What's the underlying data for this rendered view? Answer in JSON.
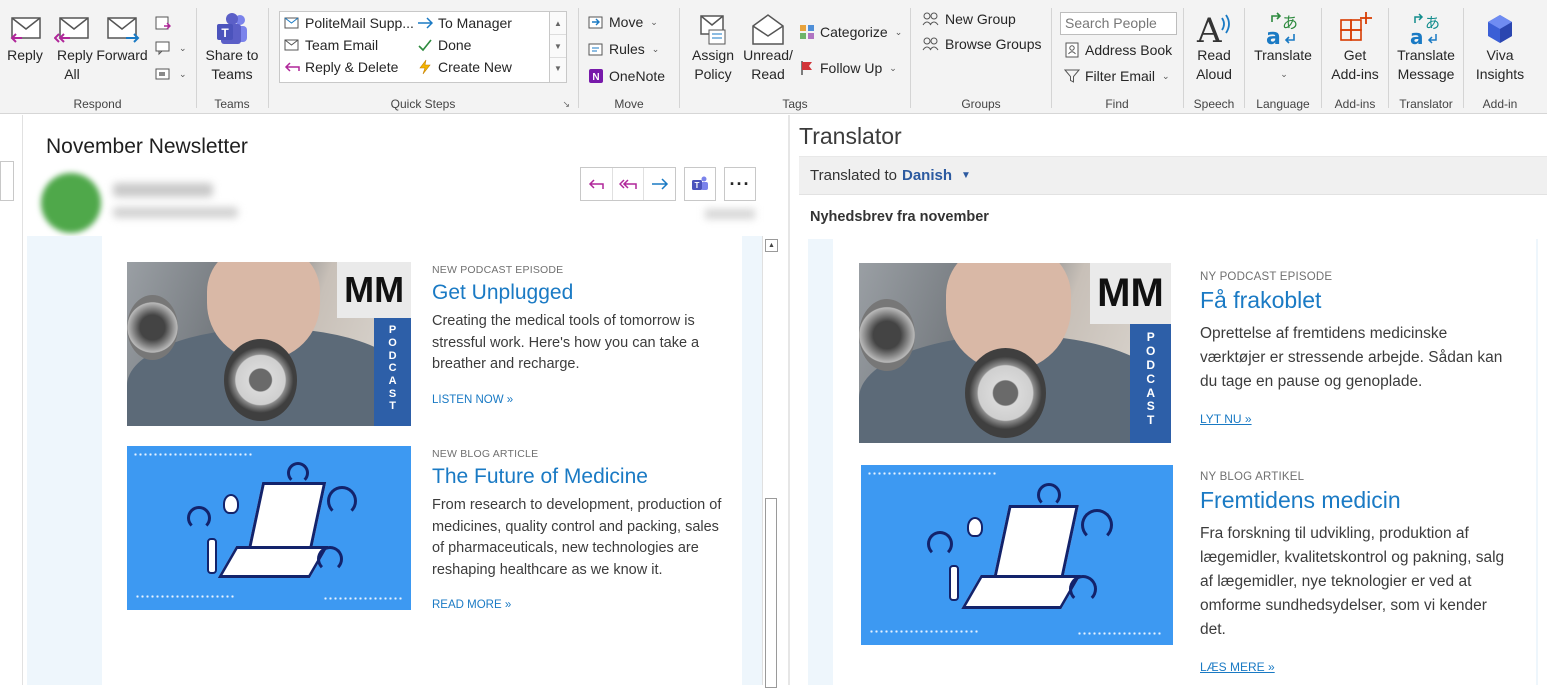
{
  "ribbon": {
    "respond": {
      "label": "Respond",
      "reply": "Reply",
      "reply_all": "Reply All",
      "forward": "Forward"
    },
    "teams": {
      "label": "Teams",
      "share_to_teams": "Share to Teams"
    },
    "quick_steps": {
      "label": "Quick Steps",
      "items": [
        "PoliteMail Supp...",
        "To Manager",
        "Team Email",
        "Done",
        "Reply & Delete",
        "Create New"
      ]
    },
    "move": {
      "label": "Move",
      "move": "Move",
      "rules": "Rules",
      "onenote": "OneNote"
    },
    "tags": {
      "label": "Tags",
      "assign_policy": "Assign Policy",
      "unread_read": "Unread/ Read",
      "categorize": "Categorize",
      "follow_up": "Follow Up"
    },
    "groups": {
      "label": "Groups",
      "new_group": "New Group",
      "browse_groups": "Browse Groups"
    },
    "find": {
      "label": "Find",
      "search_people_placeholder": "Search People",
      "address_book": "Address Book",
      "filter_email": "Filter Email"
    },
    "speech": {
      "label": "Speech",
      "read_aloud": "Read Aloud"
    },
    "language": {
      "label": "Language",
      "translate": "Translate"
    },
    "addins": {
      "label": "Add-ins",
      "get_addins": "Get Add-ins"
    },
    "translator": {
      "label": "Translator",
      "translate_message": "Translate Message"
    },
    "addin": {
      "label": "Add-in",
      "viva_insights": "Viva Insights"
    }
  },
  "message": {
    "subject": "November Newsletter",
    "articles": [
      {
        "kicker": "NEW PODCAST EPISODE",
        "title": "Get Unplugged",
        "text": "Creating the medical tools of tomorrow is stressful work. Here's how you can take a breather and recharge.",
        "link": "LISTEN NOW »"
      },
      {
        "kicker": "NEW BLOG ARTICLE",
        "title": "The Future of Medicine",
        "text": "From research to development, production of medicines, quality control and packing, sales of pharmaceuticals, new technologies are reshaping healthcare as we know it.",
        "link": "READ MORE »"
      }
    ],
    "podcast_image": {
      "logo": "MM",
      "vertical_text": "PODCAST"
    }
  },
  "translator": {
    "title": "Translator",
    "translated_to_label": "Translated to",
    "language": "Danish",
    "subject": "Nyhedsbrev fra november",
    "articles": [
      {
        "kicker": "NY PODCAST EPISODE",
        "title": "Få frakoblet",
        "text": "Oprettelse af fremtidens medicinske værktøjer er stressende arbejde. Sådan kan du tage en pause og genoplade.",
        "link": "LYT NU »"
      },
      {
        "kicker": "NY BLOG ARTIKEL",
        "title": "Fremtidens medicin",
        "text": "Fra forskning til udvikling, produktion af lægemidler, kvalitetskontrol og pakning, salg af lægemidler, nye teknologier er ved at omforme sundhedsydelser, som vi kender det.",
        "link": "LÆS MERE »"
      }
    ]
  },
  "colors": {
    "accent": "#1a7ac4",
    "teams_purple": "#5b5fc7",
    "podcast_band": "#2d5fa8",
    "blog_bg": "#3d99f2"
  }
}
